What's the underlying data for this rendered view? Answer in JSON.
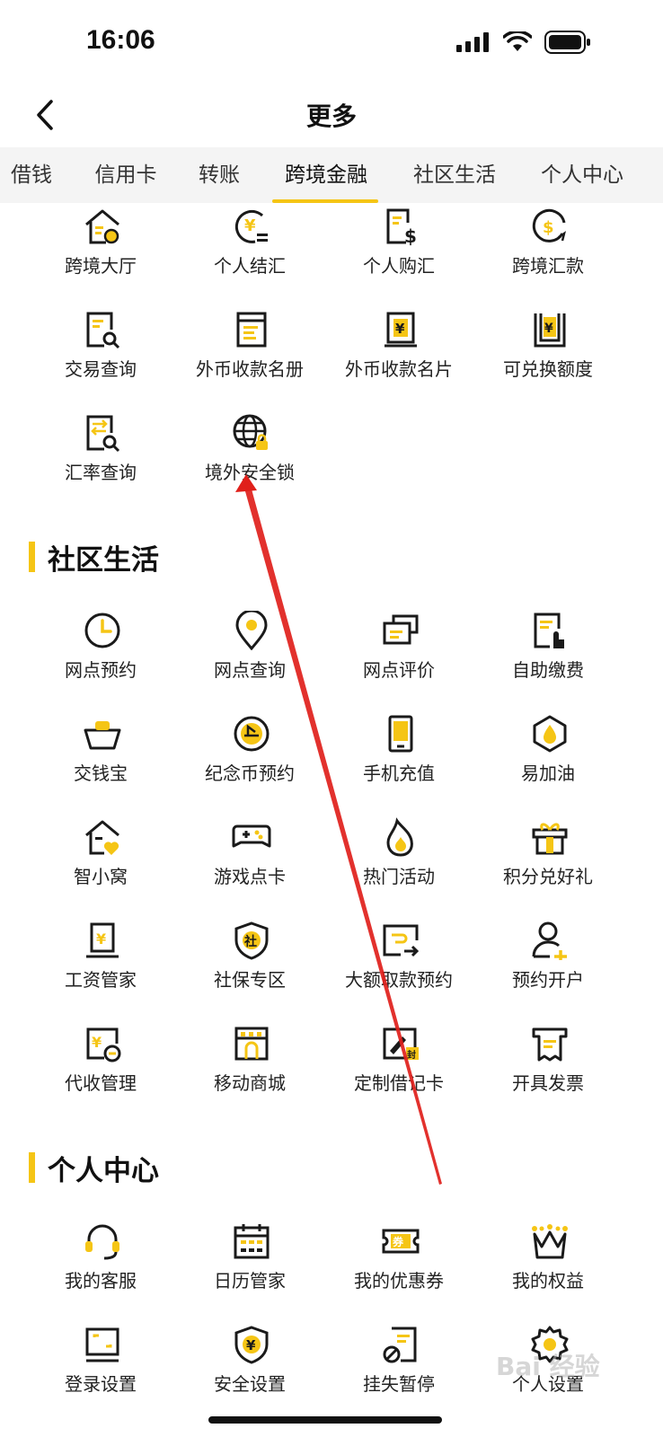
{
  "status": {
    "time": "16:06"
  },
  "nav": {
    "title": "更多"
  },
  "tabs": [
    {
      "label": "借钱"
    },
    {
      "label": "信用卡"
    },
    {
      "label": "转账"
    },
    {
      "label": "跨境金融",
      "active": true
    },
    {
      "label": "社区生活"
    },
    {
      "label": "个人中心"
    }
  ],
  "cross_border": {
    "items": [
      {
        "label": "跨境大厅",
        "icon": "house-search-icon"
      },
      {
        "label": "个人结汇",
        "icon": "yen-exchange-icon"
      },
      {
        "label": "个人购汇",
        "icon": "doc-dollar-icon"
      },
      {
        "label": "跨境汇款",
        "icon": "dollar-circle-icon"
      },
      {
        "label": "交易查询",
        "icon": "doc-search-icon"
      },
      {
        "label": "外币收款名册",
        "icon": "ledger-icon"
      },
      {
        "label": "外币收款名片",
        "icon": "yen-card-icon"
      },
      {
        "label": "可兑换额度",
        "icon": "yen-quota-icon"
      },
      {
        "label": "汇率查询",
        "icon": "rate-search-icon"
      },
      {
        "label": "境外安全锁",
        "icon": "globe-lock-icon"
      }
    ]
  },
  "community": {
    "title": "社区生活",
    "items": [
      {
        "label": "网点预约",
        "icon": "clock-icon"
      },
      {
        "label": "网点查询",
        "icon": "location-pin-icon"
      },
      {
        "label": "网点评价",
        "icon": "cards-icon"
      },
      {
        "label": "自助缴费",
        "icon": "bill-touch-icon"
      },
      {
        "label": "交钱宝",
        "icon": "ingot-icon"
      },
      {
        "label": "纪念币预约",
        "icon": "coin-icon"
      },
      {
        "label": "手机充值",
        "icon": "phone-icon"
      },
      {
        "label": "易加油",
        "icon": "fuel-drop-icon"
      },
      {
        "label": "智小窝",
        "icon": "house-heart-icon"
      },
      {
        "label": "游戏点卡",
        "icon": "gamepad-icon"
      },
      {
        "label": "热门活动",
        "icon": "flame-icon"
      },
      {
        "label": "积分兑好礼",
        "icon": "gift-icon"
      },
      {
        "label": "工资管家",
        "icon": "salary-icon"
      },
      {
        "label": "社保专区",
        "icon": "shield-she-icon"
      },
      {
        "label": "大额取款预约",
        "icon": "withdraw-icon"
      },
      {
        "label": "预约开户",
        "icon": "user-add-icon"
      },
      {
        "label": "代收管理",
        "icon": "collect-icon"
      },
      {
        "label": "移动商城",
        "icon": "store-icon"
      },
      {
        "label": "定制借记卡",
        "icon": "custom-card-icon"
      },
      {
        "label": "开具发票",
        "icon": "invoice-icon"
      }
    ]
  },
  "personal": {
    "title": "个人中心",
    "items": [
      {
        "label": "我的客服",
        "icon": "headset-icon"
      },
      {
        "label": "日历管家",
        "icon": "calendar-icon"
      },
      {
        "label": "我的优惠券",
        "icon": "coupon-icon"
      },
      {
        "label": "我的权益",
        "icon": "crown-icon"
      },
      {
        "label": "登录设置",
        "icon": "login-screen-icon"
      },
      {
        "label": "安全设置",
        "icon": "shield-yen-icon"
      },
      {
        "label": "挂失暂停",
        "icon": "doc-block-icon"
      },
      {
        "label": "个人设置",
        "icon": "gear-icon"
      }
    ]
  },
  "watermark": "Bai 经验",
  "colors": {
    "accent": "#f5c515",
    "icon_dark": "#1a1a1a",
    "annotation": "#e0201b"
  }
}
